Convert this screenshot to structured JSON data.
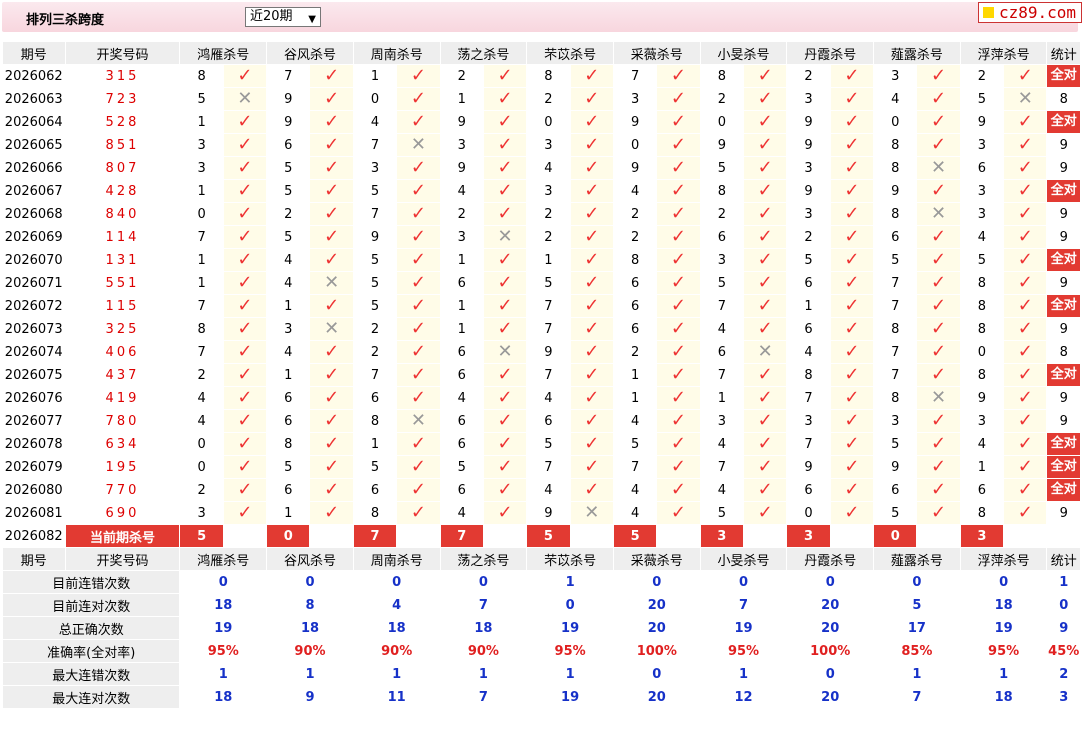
{
  "header": {
    "title": "排列三杀跨度",
    "range_select": "近20期",
    "logo_text": "cz89.com"
  },
  "columns": {
    "issue": "期号",
    "draw": "开奖号码",
    "experts": [
      "鸿雁杀号",
      "谷风杀号",
      "周南杀号",
      "荡之杀号",
      "芣苡杀号",
      "采薇杀号",
      "小旻杀号",
      "丹霞杀号",
      "薤露杀号",
      "浮萍杀号"
    ],
    "stat": "统计"
  },
  "rows": [
    {
      "issue": "2026062",
      "draw": "315",
      "kills": [
        [
          "8",
          "ok"
        ],
        [
          "7",
          "ok"
        ],
        [
          "1",
          "ok"
        ],
        [
          "2",
          "ok"
        ],
        [
          "8",
          "ok"
        ],
        [
          "7",
          "ok"
        ],
        [
          "8",
          "ok"
        ],
        [
          "2",
          "ok"
        ],
        [
          "3",
          "ok"
        ],
        [
          "2",
          "ok"
        ]
      ],
      "stat": "全对"
    },
    {
      "issue": "2026063",
      "draw": "723",
      "kills": [
        [
          "5",
          "bad"
        ],
        [
          "9",
          "ok"
        ],
        [
          "0",
          "ok"
        ],
        [
          "1",
          "ok"
        ],
        [
          "2",
          "ok"
        ],
        [
          "3",
          "ok"
        ],
        [
          "2",
          "ok"
        ],
        [
          "3",
          "ok"
        ],
        [
          "4",
          "ok"
        ],
        [
          "5",
          "bad"
        ]
      ],
      "stat": "8"
    },
    {
      "issue": "2026064",
      "draw": "528",
      "kills": [
        [
          "1",
          "ok"
        ],
        [
          "9",
          "ok"
        ],
        [
          "4",
          "ok"
        ],
        [
          "9",
          "ok"
        ],
        [
          "0",
          "ok"
        ],
        [
          "9",
          "ok"
        ],
        [
          "0",
          "ok"
        ],
        [
          "9",
          "ok"
        ],
        [
          "0",
          "ok"
        ],
        [
          "9",
          "ok"
        ]
      ],
      "stat": "全对"
    },
    {
      "issue": "2026065",
      "draw": "851",
      "kills": [
        [
          "3",
          "ok"
        ],
        [
          "6",
          "ok"
        ],
        [
          "7",
          "bad"
        ],
        [
          "3",
          "ok"
        ],
        [
          "3",
          "ok"
        ],
        [
          "0",
          "ok"
        ],
        [
          "9",
          "ok"
        ],
        [
          "9",
          "ok"
        ],
        [
          "8",
          "ok"
        ],
        [
          "3",
          "ok"
        ]
      ],
      "stat": "9"
    },
    {
      "issue": "2026066",
      "draw": "807",
      "kills": [
        [
          "3",
          "ok"
        ],
        [
          "5",
          "ok"
        ],
        [
          "3",
          "ok"
        ],
        [
          "9",
          "ok"
        ],
        [
          "4",
          "ok"
        ],
        [
          "9",
          "ok"
        ],
        [
          "5",
          "ok"
        ],
        [
          "3",
          "ok"
        ],
        [
          "8",
          "bad"
        ],
        [
          "6",
          "ok"
        ]
      ],
      "stat": "9"
    },
    {
      "issue": "2026067",
      "draw": "428",
      "kills": [
        [
          "1",
          "ok"
        ],
        [
          "5",
          "ok"
        ],
        [
          "5",
          "ok"
        ],
        [
          "4",
          "ok"
        ],
        [
          "3",
          "ok"
        ],
        [
          "4",
          "ok"
        ],
        [
          "8",
          "ok"
        ],
        [
          "9",
          "ok"
        ],
        [
          "9",
          "ok"
        ],
        [
          "3",
          "ok"
        ]
      ],
      "stat": "全对"
    },
    {
      "issue": "2026068",
      "draw": "840",
      "kills": [
        [
          "0",
          "ok"
        ],
        [
          "2",
          "ok"
        ],
        [
          "7",
          "ok"
        ],
        [
          "2",
          "ok"
        ],
        [
          "2",
          "ok"
        ],
        [
          "2",
          "ok"
        ],
        [
          "2",
          "ok"
        ],
        [
          "3",
          "ok"
        ],
        [
          "8",
          "bad"
        ],
        [
          "3",
          "ok"
        ]
      ],
      "stat": "9"
    },
    {
      "issue": "2026069",
      "draw": "114",
      "kills": [
        [
          "7",
          "ok"
        ],
        [
          "5",
          "ok"
        ],
        [
          "9",
          "ok"
        ],
        [
          "3",
          "bad"
        ],
        [
          "2",
          "ok"
        ],
        [
          "2",
          "ok"
        ],
        [
          "6",
          "ok"
        ],
        [
          "2",
          "ok"
        ],
        [
          "6",
          "ok"
        ],
        [
          "4",
          "ok"
        ]
      ],
      "stat": "9"
    },
    {
      "issue": "2026070",
      "draw": "131",
      "kills": [
        [
          "1",
          "ok"
        ],
        [
          "4",
          "ok"
        ],
        [
          "5",
          "ok"
        ],
        [
          "1",
          "ok"
        ],
        [
          "1",
          "ok"
        ],
        [
          "8",
          "ok"
        ],
        [
          "3",
          "ok"
        ],
        [
          "5",
          "ok"
        ],
        [
          "5",
          "ok"
        ],
        [
          "5",
          "ok"
        ]
      ],
      "stat": "全对"
    },
    {
      "issue": "2026071",
      "draw": "551",
      "kills": [
        [
          "1",
          "ok"
        ],
        [
          "4",
          "bad"
        ],
        [
          "5",
          "ok"
        ],
        [
          "6",
          "ok"
        ],
        [
          "5",
          "ok"
        ],
        [
          "6",
          "ok"
        ],
        [
          "5",
          "ok"
        ],
        [
          "6",
          "ok"
        ],
        [
          "7",
          "ok"
        ],
        [
          "8",
          "ok"
        ]
      ],
      "stat": "9"
    },
    {
      "issue": "2026072",
      "draw": "115",
      "kills": [
        [
          "7",
          "ok"
        ],
        [
          "1",
          "ok"
        ],
        [
          "5",
          "ok"
        ],
        [
          "1",
          "ok"
        ],
        [
          "7",
          "ok"
        ],
        [
          "6",
          "ok"
        ],
        [
          "7",
          "ok"
        ],
        [
          "1",
          "ok"
        ],
        [
          "7",
          "ok"
        ],
        [
          "8",
          "ok"
        ]
      ],
      "stat": "全对"
    },
    {
      "issue": "2026073",
      "draw": "325",
      "kills": [
        [
          "8",
          "ok"
        ],
        [
          "3",
          "bad"
        ],
        [
          "2",
          "ok"
        ],
        [
          "1",
          "ok"
        ],
        [
          "7",
          "ok"
        ],
        [
          "6",
          "ok"
        ],
        [
          "4",
          "ok"
        ],
        [
          "6",
          "ok"
        ],
        [
          "8",
          "ok"
        ],
        [
          "8",
          "ok"
        ]
      ],
      "stat": "9"
    },
    {
      "issue": "2026074",
      "draw": "406",
      "kills": [
        [
          "7",
          "ok"
        ],
        [
          "4",
          "ok"
        ],
        [
          "2",
          "ok"
        ],
        [
          "6",
          "bad"
        ],
        [
          "9",
          "ok"
        ],
        [
          "2",
          "ok"
        ],
        [
          "6",
          "bad"
        ],
        [
          "4",
          "ok"
        ],
        [
          "7",
          "ok"
        ],
        [
          "0",
          "ok"
        ]
      ],
      "stat": "8"
    },
    {
      "issue": "2026075",
      "draw": "437",
      "kills": [
        [
          "2",
          "ok"
        ],
        [
          "1",
          "ok"
        ],
        [
          "7",
          "ok"
        ],
        [
          "6",
          "ok"
        ],
        [
          "7",
          "ok"
        ],
        [
          "1",
          "ok"
        ],
        [
          "7",
          "ok"
        ],
        [
          "8",
          "ok"
        ],
        [
          "7",
          "ok"
        ],
        [
          "8",
          "ok"
        ]
      ],
      "stat": "全对"
    },
    {
      "issue": "2026076",
      "draw": "419",
      "kills": [
        [
          "4",
          "ok"
        ],
        [
          "6",
          "ok"
        ],
        [
          "6",
          "ok"
        ],
        [
          "4",
          "ok"
        ],
        [
          "4",
          "ok"
        ],
        [
          "1",
          "ok"
        ],
        [
          "1",
          "ok"
        ],
        [
          "7",
          "ok"
        ],
        [
          "8",
          "bad"
        ],
        [
          "9",
          "ok"
        ]
      ],
      "stat": "9"
    },
    {
      "issue": "2026077",
      "draw": "780",
      "kills": [
        [
          "4",
          "ok"
        ],
        [
          "6",
          "ok"
        ],
        [
          "8",
          "bad"
        ],
        [
          "6",
          "ok"
        ],
        [
          "6",
          "ok"
        ],
        [
          "4",
          "ok"
        ],
        [
          "3",
          "ok"
        ],
        [
          "3",
          "ok"
        ],
        [
          "3",
          "ok"
        ],
        [
          "3",
          "ok"
        ]
      ],
      "stat": "9"
    },
    {
      "issue": "2026078",
      "draw": "634",
      "kills": [
        [
          "0",
          "ok"
        ],
        [
          "8",
          "ok"
        ],
        [
          "1",
          "ok"
        ],
        [
          "6",
          "ok"
        ],
        [
          "5",
          "ok"
        ],
        [
          "5",
          "ok"
        ],
        [
          "4",
          "ok"
        ],
        [
          "7",
          "ok"
        ],
        [
          "5",
          "ok"
        ],
        [
          "4",
          "ok"
        ]
      ],
      "stat": "全对"
    },
    {
      "issue": "2026079",
      "draw": "195",
      "kills": [
        [
          "0",
          "ok"
        ],
        [
          "5",
          "ok"
        ],
        [
          "5",
          "ok"
        ],
        [
          "5",
          "ok"
        ],
        [
          "7",
          "ok"
        ],
        [
          "7",
          "ok"
        ],
        [
          "7",
          "ok"
        ],
        [
          "9",
          "ok"
        ],
        [
          "9",
          "ok"
        ],
        [
          "1",
          "ok"
        ]
      ],
      "stat": "全对"
    },
    {
      "issue": "2026080",
      "draw": "770",
      "kills": [
        [
          "2",
          "ok"
        ],
        [
          "6",
          "ok"
        ],
        [
          "6",
          "ok"
        ],
        [
          "6",
          "ok"
        ],
        [
          "4",
          "ok"
        ],
        [
          "4",
          "ok"
        ],
        [
          "4",
          "ok"
        ],
        [
          "6",
          "ok"
        ],
        [
          "6",
          "ok"
        ],
        [
          "6",
          "ok"
        ]
      ],
      "stat": "全对"
    },
    {
      "issue": "2026081",
      "draw": "690",
      "kills": [
        [
          "3",
          "ok"
        ],
        [
          "1",
          "ok"
        ],
        [
          "8",
          "ok"
        ],
        [
          "4",
          "ok"
        ],
        [
          "9",
          "bad"
        ],
        [
          "4",
          "ok"
        ],
        [
          "5",
          "ok"
        ],
        [
          "0",
          "ok"
        ],
        [
          "5",
          "ok"
        ],
        [
          "8",
          "ok"
        ]
      ],
      "stat": "9"
    }
  ],
  "current": {
    "issue": "2026082",
    "label": "当前期杀号",
    "kills": [
      "5",
      "0",
      "7",
      "7",
      "5",
      "5",
      "3",
      "3",
      "0",
      "3"
    ]
  },
  "summary": [
    {
      "label": "目前连错次数",
      "values": [
        "0",
        "0",
        "0",
        "0",
        "1",
        "0",
        "0",
        "0",
        "0",
        "0",
        "1"
      ],
      "style": "sv"
    },
    {
      "label": "目前连对次数",
      "values": [
        "18",
        "8",
        "4",
        "7",
        "0",
        "20",
        "7",
        "20",
        "5",
        "18",
        "0"
      ],
      "style": "sv"
    },
    {
      "label": "总正确次数",
      "values": [
        "19",
        "18",
        "18",
        "18",
        "19",
        "20",
        "19",
        "20",
        "17",
        "19",
        "9"
      ],
      "style": "sv"
    },
    {
      "label": "准确率(全对率)",
      "values": [
        "95%",
        "90%",
        "90%",
        "90%",
        "95%",
        "100%",
        "95%",
        "100%",
        "85%",
        "95%",
        "45%"
      ],
      "style": "sr"
    },
    {
      "label": "最大连错次数",
      "values": [
        "1",
        "1",
        "1",
        "1",
        "1",
        "0",
        "1",
        "0",
        "1",
        "1",
        "2"
      ],
      "style": "sv"
    },
    {
      "label": "最大连对次数",
      "values": [
        "18",
        "9",
        "11",
        "7",
        "19",
        "20",
        "12",
        "20",
        "7",
        "18",
        "3"
      ],
      "style": "sv"
    }
  ]
}
